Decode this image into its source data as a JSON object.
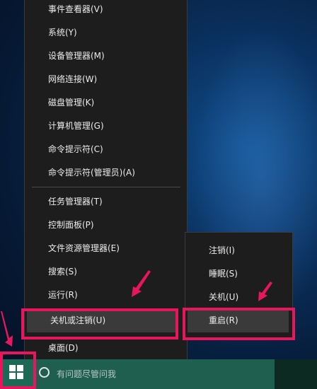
{
  "context_menu": {
    "items": [
      {
        "label": "事件查看器(V)"
      },
      {
        "label": "系统(Y)"
      },
      {
        "label": "设备管理器(M)"
      },
      {
        "label": "网络连接(W)"
      },
      {
        "label": "磁盘管理(K)"
      },
      {
        "label": "计算机管理(G)"
      },
      {
        "label": "命令提示符(C)"
      },
      {
        "label": "命令提示符(管理员)(A)"
      },
      {
        "label": "任务管理器(T)"
      },
      {
        "label": "控制面板(P)"
      },
      {
        "label": "文件资源管理器(E)"
      },
      {
        "label": "搜索(S)"
      },
      {
        "label": "运行(R)"
      },
      {
        "label": "关机或注销(U)"
      },
      {
        "label": "桌面(D)"
      }
    ]
  },
  "submenu": {
    "items": [
      {
        "label": "注销(I)"
      },
      {
        "label": "睡眠(S)"
      },
      {
        "label": "关机(U)"
      },
      {
        "label": "重启(R)"
      }
    ]
  },
  "taskbar": {
    "search_placeholder": "有问题尽管问我"
  },
  "colors": {
    "highlight": "#e8175d",
    "menu_bg": "#1d1d1d",
    "taskbar_search": "#1f5f4f",
    "start_button": "#1c6a55"
  },
  "icons": [
    "windows-logo-icon",
    "search-circle-icon",
    "arrow-icon"
  ]
}
